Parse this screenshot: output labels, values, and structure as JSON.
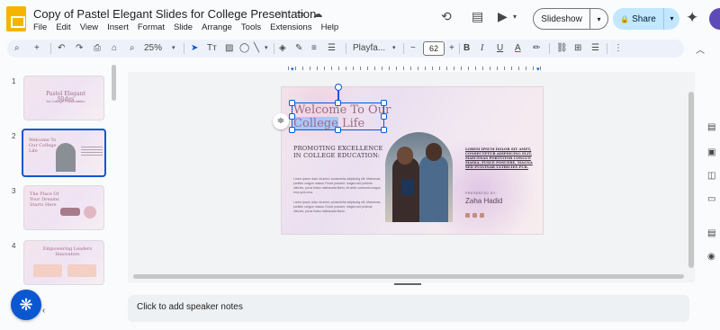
{
  "header": {
    "doc_title": "Copy of Pastel Elegant Slides for College Presentation",
    "title_icons": [
      "star-icon",
      "move-folder-icon",
      "cloud-status-icon"
    ],
    "menu": [
      "File",
      "Edit",
      "View",
      "Insert",
      "Format",
      "Slide",
      "Arrange",
      "Tools",
      "Extensions",
      "Help"
    ],
    "slideshow_label": "Slideshow",
    "share_label": "Share"
  },
  "toolbar": {
    "zoom": "25%",
    "font_name": "Playfa...",
    "font_size": "62",
    "minus": "−",
    "plus": "+"
  },
  "filmstrip": {
    "slides": [
      {
        "number": "1",
        "title": "Pastel Elegant Slides",
        "subtitle": "for College Presentation"
      },
      {
        "number": "2",
        "title": "Welcome To Our College Life"
      },
      {
        "number": "3",
        "title": "The Place Of Your Dreams Starts Here"
      },
      {
        "number": "4",
        "title": "Empowering Leaders Innovators"
      }
    ],
    "selected_index": 1
  },
  "slide": {
    "title_part1": "Welcome To Our ",
    "title_part2": "College",
    "title_part3": " Life",
    "heading": "PROMOTING EXCELLENCE IN COLLEGE EDUCATION:",
    "para1": "Lorem ipsum dolor sit amet, consectetur adipiscing elit. Maecenas porttitor congue massa. Fusce posuere, magna sed pulvinar ultricies, purus lectus malesuada libero, sit amet commodo magna eros quis urna.",
    "para2": "Lorem ipsum dolor sit amet, consectetur adipiscing elit. Maecenas porttitor congue massa. Fusce posuere, magna sed pulvinar ultricies, purus lectus malesuada libero.",
    "right_text": "LOREM IPSUM DOLOR SIT AMET, CONSECTETUR ADIPISCING ELIT. MAECENAS PORTTITOR CONGUE MASSA. FUSCE POSUERE, MAGNA SED PULVINAR ULTRICIES PUR.",
    "presented_by": "PRESENTED BY:",
    "presenter_name": "Zaha Hadid"
  },
  "notes": {
    "placeholder": "Click to add speaker notes"
  },
  "colors": {
    "accent": "#0b57d0",
    "share_bg": "#c2e7ff",
    "slides_logo": "#f4b400",
    "slide_title": "#9b6b86"
  }
}
